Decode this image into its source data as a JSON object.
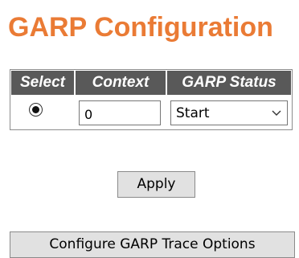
{
  "page": {
    "title": "GARP Configuration",
    "accent_color": "#ea7b35",
    "header_bg_color": "#595959"
  },
  "table": {
    "headers": {
      "select": "Select",
      "context": "Context",
      "status": "GARP Status"
    },
    "rows": [
      {
        "selected": true,
        "context": "0",
        "status": "Start"
      }
    ]
  },
  "buttons": {
    "apply": "Apply",
    "trace": "Configure GARP Trace Options"
  },
  "icons": {
    "dropdown": "chevron-down-icon"
  }
}
